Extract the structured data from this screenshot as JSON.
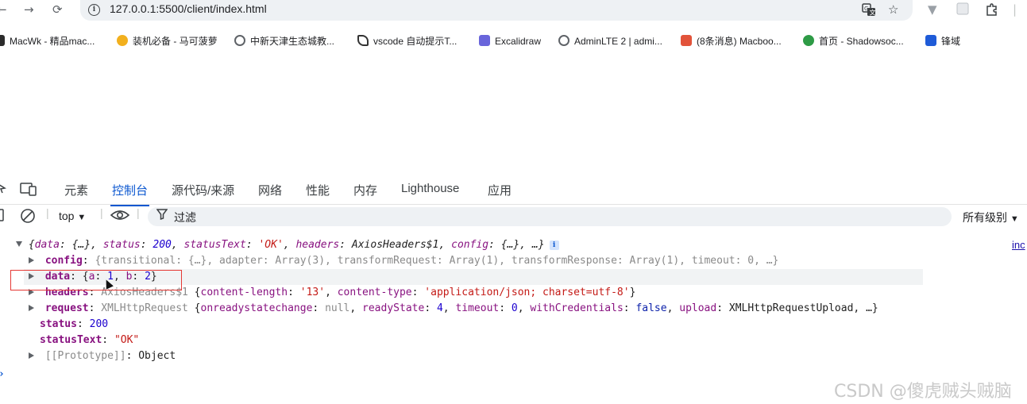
{
  "browser": {
    "url": "127.0.0.1:5500/client/index.html",
    "nav_icons": {
      "back": "←",
      "forward": "→",
      "reload": "⟳"
    },
    "right_icons": [
      "translate-icon",
      "star-icon",
      "shield-icon",
      "extension-icon",
      "puzzle-icon"
    ],
    "bookmarks": [
      {
        "label": "MacWk - 精品mac...",
        "icon_color": "#2b2b2b"
      },
      {
        "label": "装机必备 - 马可菠萝",
        "icon_color": "#f2b01e"
      },
      {
        "label": "中新天津生态城教...",
        "icon_color": "#5f6368"
      },
      {
        "label": "vscode 自动提示T...",
        "icon_color": "#333333"
      },
      {
        "label": "Excalidraw",
        "icon_color": "#6965db"
      },
      {
        "label": "AdminLTE 2 | admi...",
        "icon_color": "#5f6368"
      },
      {
        "label": "(8条消息) Macboo...",
        "icon_color": "#e2533a"
      },
      {
        "label": "首页 - Shadowsoc...",
        "icon_color": "#2e9b46"
      },
      {
        "label": "锋域",
        "icon_color": "#1e5bd8"
      }
    ]
  },
  "devtools": {
    "tabs": [
      "元素",
      "控制台",
      "源代码/来源",
      "网络",
      "性能",
      "内存",
      "Lighthouse",
      "应用"
    ],
    "active_tab": "控制台",
    "context": "top",
    "filter_placeholder": "过滤",
    "levels": "所有级别",
    "right_link": "inc"
  },
  "console": {
    "summary": {
      "open": "{",
      "k1": "data",
      "v1": "{…}",
      "k2": "status",
      "v2": "200",
      "k3": "statusText",
      "v3": "'OK'",
      "k4": "headers",
      "v4": "AxiosHeaders$1",
      "k5": "config",
      "v5": "{…}",
      "tail": ", …}"
    },
    "config_row": {
      "key": "config",
      "text": "{transitional: {…}, adapter: Array(3), transformRequest: Array(1), transformResponse: Array(1), timeout: 0, …}"
    },
    "data_row": {
      "key": "data",
      "open": "{",
      "a_key": "a",
      "a_val": "1",
      "b_key": "b",
      "b_val": "2",
      "close": "}"
    },
    "headers_row": {
      "key": "headers",
      "cls": "AxiosHeaders$1",
      "k1": "content-length",
      "v1": "'13'",
      "k2": "content-type",
      "v2": "'application/json; charset=utf-8'"
    },
    "request_row": {
      "key": "request",
      "cls": "XMLHttpRequest",
      "k1": "onreadystatechange",
      "v1": "null",
      "k2": "readyState",
      "v2": "4",
      "k3": "timeout",
      "v3": "0",
      "k4": "withCredentials",
      "v4": "false",
      "k5": "upload",
      "v5": "XMLHttpRequestUpload",
      "tail": ", …}"
    },
    "status_row": {
      "key": "status",
      "value": "200"
    },
    "statusText_row": {
      "key": "statusText",
      "value": "\"OK\""
    },
    "prototype_row": {
      "key": "[[Prototype]]",
      "value": "Object"
    }
  },
  "watermark": "CSDN @傻虎贼头贼脑"
}
